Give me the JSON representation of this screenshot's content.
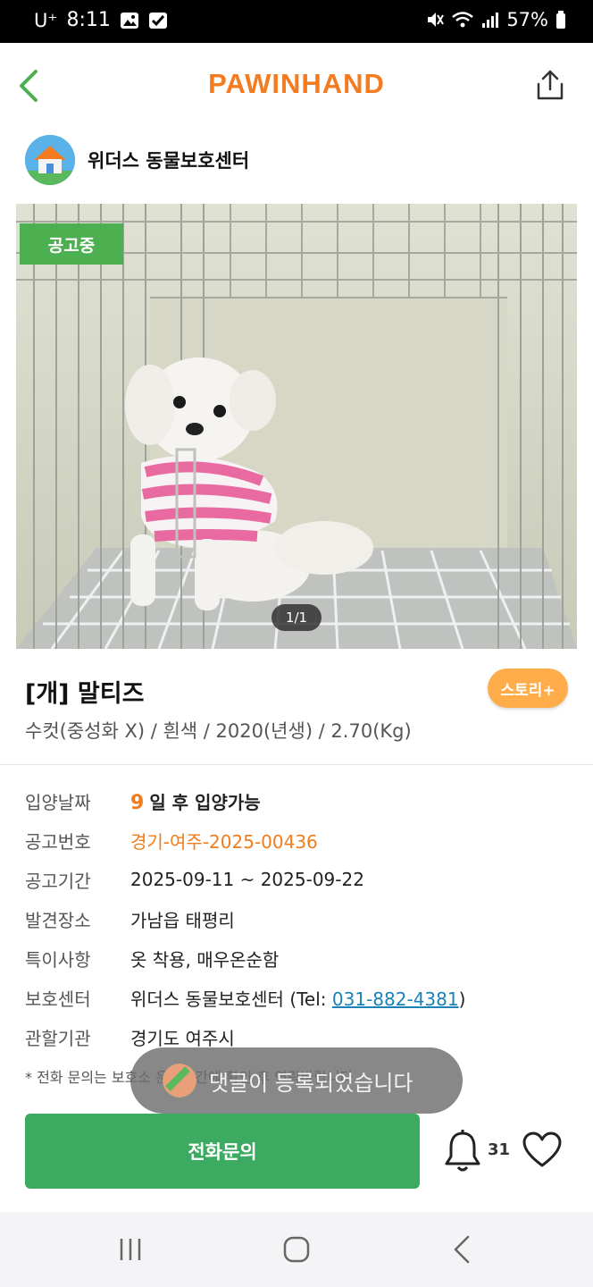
{
  "status_bar": {
    "carrier": "U⁺",
    "time": "8:11",
    "battery": "57%"
  },
  "header": {
    "logo": "PAWINHAND",
    "back_icon": "chevron-left-icon",
    "share_icon": "share-icon"
  },
  "shelter": {
    "name": "위더스 동물보호센터"
  },
  "photo": {
    "status_badge": "공고중",
    "counter": "1/1"
  },
  "pet": {
    "title": "[개] 말티즈",
    "story_button": "스토리+",
    "subtitle": "수컷(중성화 X) / 흰색 / 2020(년생) / 2.70(Kg)"
  },
  "info": {
    "adoption_date": {
      "label": "입양날짜",
      "days": "9",
      "text": "일 후 입양가능"
    },
    "notice_no": {
      "label": "공고번호",
      "value": "경기-여주-2025-00436"
    },
    "notice_period": {
      "label": "공고기간",
      "value": "2025-09-11 ~ 2025-09-22"
    },
    "found_place": {
      "label": "발견장소",
      "value": "가남읍 태평리"
    },
    "features": {
      "label": "특이사항",
      "value": "옷 착용, 매우온순함"
    },
    "center": {
      "label": "보호센터",
      "name": "위더스 동물보호센터 (Tel: ",
      "tel": "031-882-4381",
      "close": ")"
    },
    "agency": {
      "label": "관할기관",
      "value": "경기도 여주시"
    }
  },
  "note": "* 전화 문의는 보호소 운영시간에 확인 후 연락바랍니다",
  "toast": {
    "message": "댓글이 등록되었습니다"
  },
  "actions": {
    "call_button": "전화문의",
    "bell_count": "31"
  },
  "colors": {
    "brand_orange": "#f47b20",
    "green": "#3daa62",
    "story_orange": "#ffac4a",
    "link_blue": "#1a82b5"
  }
}
